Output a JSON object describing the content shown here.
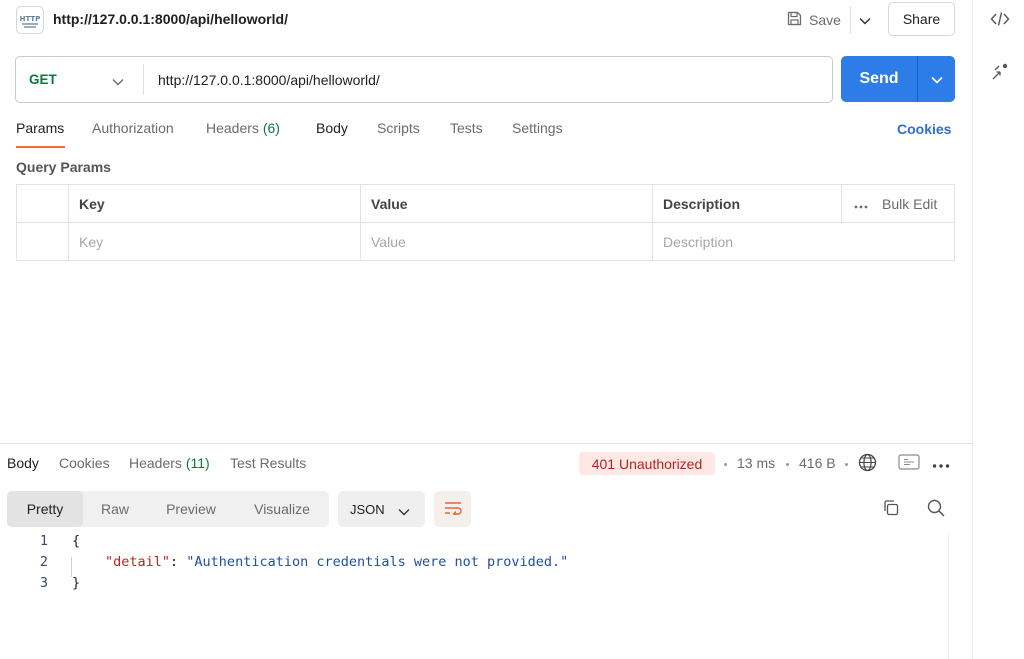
{
  "header": {
    "tab_title": "http://127.0.0.1:8000/api/helloworld/",
    "http_icon_label": "HTTP",
    "save_label": "Save",
    "share_label": "Share"
  },
  "request": {
    "method": "GET",
    "url": "http://127.0.0.1:8000/api/helloworld/",
    "send_label": "Send",
    "tabs": [
      {
        "label": "Params"
      },
      {
        "label": "Authorization"
      },
      {
        "label": "Headers",
        "count": "(6)"
      },
      {
        "label": "Body"
      },
      {
        "label": "Scripts"
      },
      {
        "label": "Tests"
      },
      {
        "label": "Settings"
      }
    ],
    "cookies_label": "Cookies"
  },
  "query_params": {
    "title": "Query Params",
    "headers": [
      "Key",
      "Value",
      "Description"
    ],
    "placeholders": [
      "Key",
      "Value",
      "Description"
    ],
    "bulk_edit_label": "Bulk Edit"
  },
  "response": {
    "tabs": [
      {
        "label": "Body"
      },
      {
        "label": "Cookies"
      },
      {
        "label": "Headers",
        "count": "(11)"
      },
      {
        "label": "Test Results"
      }
    ],
    "status": "401 Unauthorized",
    "time": "13 ms",
    "size": "416 B",
    "view_modes": [
      "Pretty",
      "Raw",
      "Preview",
      "Visualize"
    ],
    "format": "JSON",
    "lines": [
      {
        "num": "1",
        "open": "{"
      },
      {
        "num": "2",
        "key": "\"detail\"",
        "sep": ": ",
        "value": "\"Authentication credentials were not provided.\""
      },
      {
        "num": "3",
        "close": "}"
      }
    ]
  },
  "colors": {
    "accent_tab": "#f26b3a",
    "send": "#2d7ce8",
    "method": "#0b7a3e",
    "error_badge_bg": "#fde8e5",
    "error_badge_text": "#b3261e"
  }
}
